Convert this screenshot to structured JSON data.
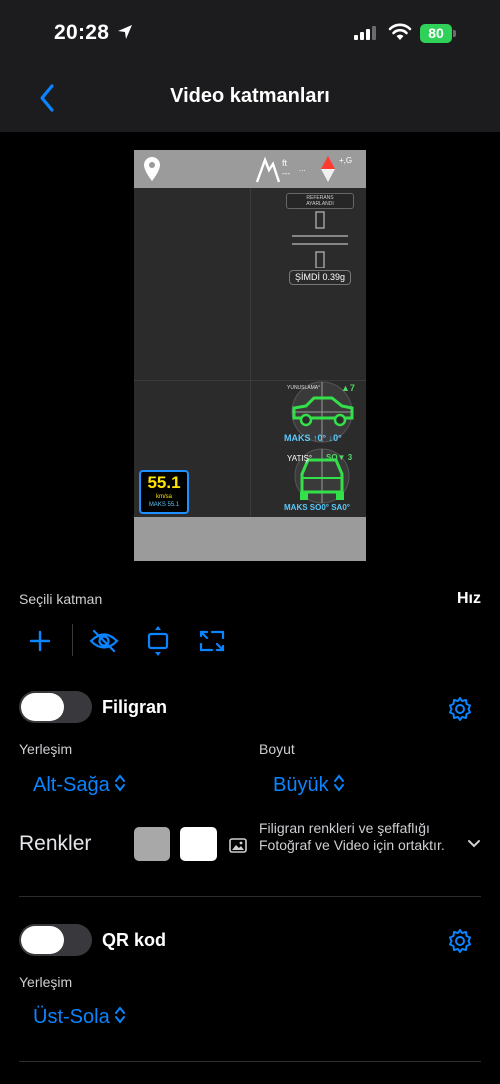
{
  "status_bar": {
    "time": "20:28",
    "battery": "80"
  },
  "nav": {
    "title": "Video katmanları"
  },
  "preview": {
    "ft_label": "ft",
    "ft_value": "---",
    "dots": "...",
    "g_label": "+,G",
    "reference": "REFERANS\nAYARLANDI",
    "now": "ŞİMDİ 0.39g",
    "tilt1_up": "▲7",
    "tilt1_max": "MAKS ↑0° ↓0°",
    "tilt2_label": "YATIŞ°",
    "tilt2_so": "SO▼ 3",
    "tilt2_max": "MAKS SO0° SA0°",
    "speed_value": "55.1",
    "speed_unit": "km/sa",
    "speed_max": "MAKS 55.1"
  },
  "layers": {
    "selected_label": "Seçili katman",
    "selected_value": "Hız"
  },
  "watermark": {
    "label": "Filigran",
    "placement_label": "Yerleşim",
    "placement_value": "Alt-Sağa",
    "size_label": "Boyut",
    "size_value": "Büyük",
    "colors_label": "Renkler",
    "colors_note": "Filigran renkleri ve şeffaflığı Fotoğraf ve Video için ortaktır.",
    "color_swatches": [
      "#a8a8a8",
      "#ffffff"
    ]
  },
  "qr": {
    "label": "QR kod",
    "placement_label": "Yerleşim",
    "placement_value": "Üst-Sola"
  },
  "accent_color": "#0a84ff"
}
